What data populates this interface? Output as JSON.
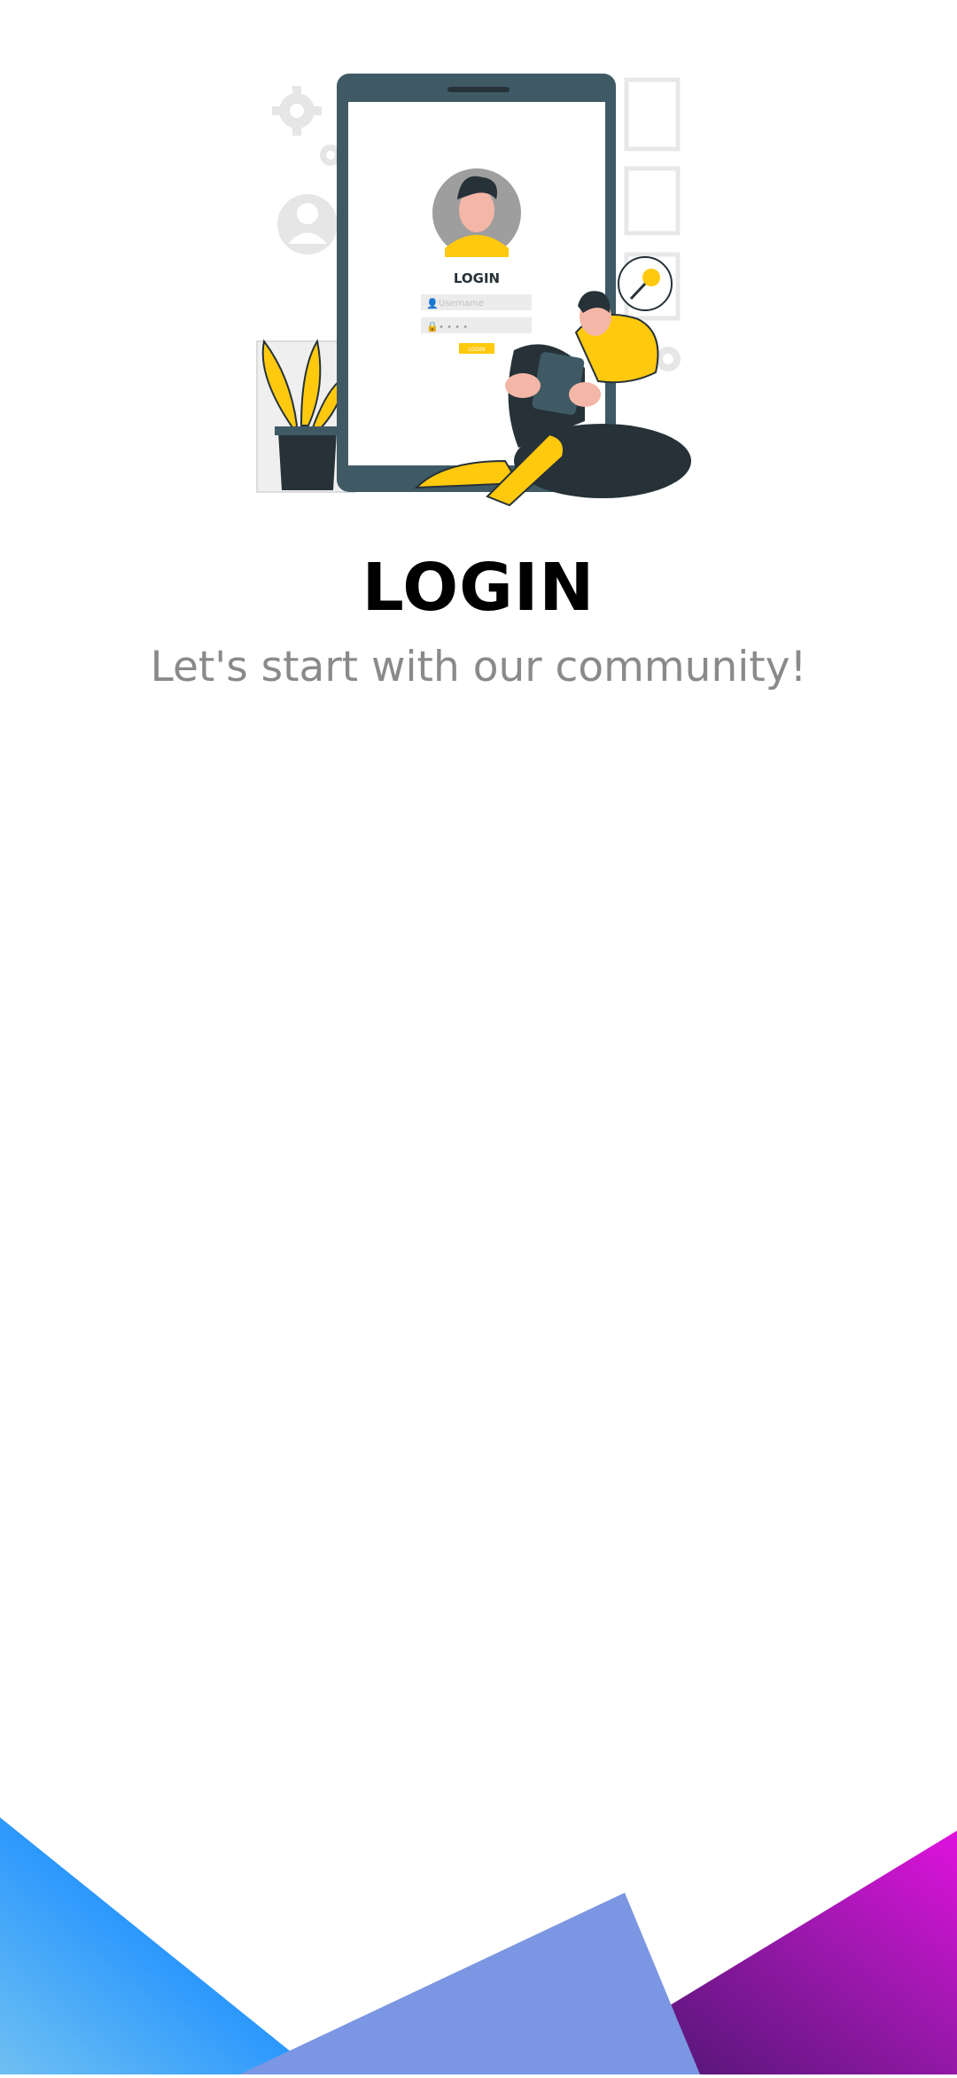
{
  "illustration": {
    "screen_title": "LOGIN",
    "username_placeholder": "Username",
    "password_mask": "• • • •",
    "login_button_label": "LOGIN"
  },
  "page": {
    "title": "LOGIN",
    "subtitle": "Let's start with our community!"
  },
  "colors": {
    "accent": "#FFC90E",
    "phone_frame": "#3F5A65",
    "dark": "#263238",
    "blue_gradient_end": "#1E90FF",
    "purple": "#7B96E2",
    "magenta": "#D616D8"
  }
}
